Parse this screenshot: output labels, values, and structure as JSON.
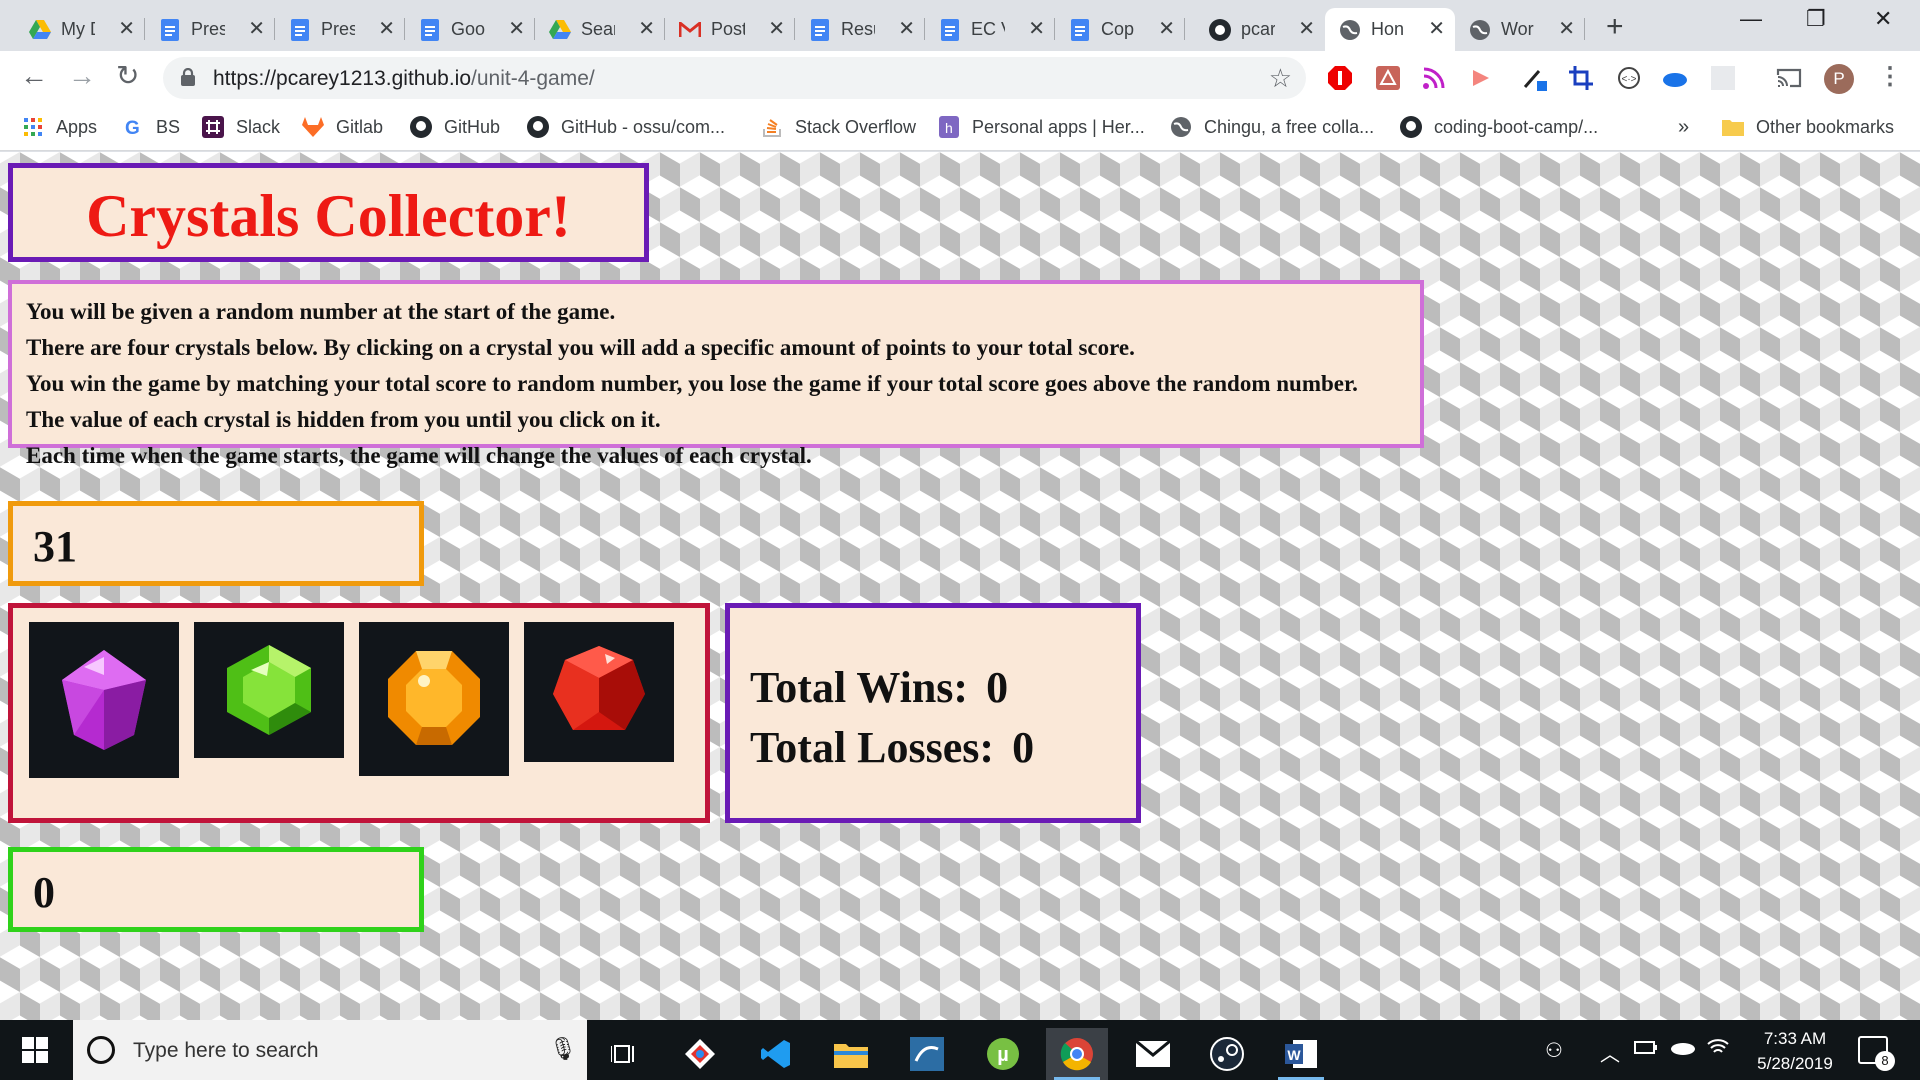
{
  "browser": {
    "tabs": [
      {
        "title": "My D",
        "icon": "google-drive-icon"
      },
      {
        "title": "Pres",
        "icon": "google-docs-icon"
      },
      {
        "title": "Pres",
        "icon": "google-docs-icon"
      },
      {
        "title": "Goo",
        "icon": "google-docs-icon"
      },
      {
        "title": "Sear",
        "icon": "google-drive-icon"
      },
      {
        "title": "Post",
        "icon": "gmail-icon"
      },
      {
        "title": "Resu",
        "icon": "google-docs-icon"
      },
      {
        "title": "EC V",
        "icon": "google-docs-icon"
      },
      {
        "title": "Cop",
        "icon": "google-docs-icon"
      },
      {
        "title": "pcar",
        "icon": "github-icon"
      },
      {
        "title": "Hon",
        "icon": "globe-icon",
        "active": true
      },
      {
        "title": "Wor",
        "icon": "globe-icon"
      }
    ],
    "address": {
      "host": "https://pcarey1213.github.io",
      "path": "/unit-4-game/"
    },
    "profile_initial": "P",
    "bookmarks": [
      {
        "label": "Apps",
        "icon": "apps-grid-icon"
      },
      {
        "label": "BS",
        "icon": "google-g-icon"
      },
      {
        "label": "Slack",
        "icon": "slack-icon"
      },
      {
        "label": "Gitlab",
        "icon": "gitlab-icon"
      },
      {
        "label": "GitHub",
        "icon": "github-icon"
      },
      {
        "label": "GitHub - ossu/com...",
        "icon": "github-icon"
      },
      {
        "label": "Stack Overflow",
        "icon": "stack-overflow-icon"
      },
      {
        "label": "Personal apps | Her...",
        "icon": "heroku-icon"
      },
      {
        "label": "Chingu, a free colla...",
        "icon": "globe-icon"
      },
      {
        "label": "coding-boot-camp/...",
        "icon": "github-icon"
      }
    ],
    "overflow": "»",
    "other_bookmarks": "Other bookmarks"
  },
  "game": {
    "title": "Crystals Collector!",
    "instructions": [
      "You will be given a random number at the start of the game.",
      "There are four crystals below. By clicking on a crystal you will add a specific amount of points to your total score.",
      "You win the game by matching your total score to random number, you lose the game if your total score goes above the random number.",
      "The value of each crystal is hidden from you until you click on it.",
      "Each time when the game starts, the game will change the values of each crystal."
    ],
    "target_number": "31",
    "crystals": [
      {
        "name": "purple-crystal",
        "color": "#c23ad6"
      },
      {
        "name": "green-crystal",
        "color": "#5fd21c"
      },
      {
        "name": "orange-crystal",
        "color": "#f59a0c"
      },
      {
        "name": "red-crystal",
        "color": "#e3211f"
      }
    ],
    "wins_label": "Total Wins:",
    "wins_value": "0",
    "losses_label": "Total Losses:",
    "losses_value": "0",
    "total_score": "0"
  },
  "taskbar": {
    "search_placeholder": "Type here to search",
    "time": "7:33 AM",
    "date": "5/28/2019",
    "notification_count": "8"
  }
}
